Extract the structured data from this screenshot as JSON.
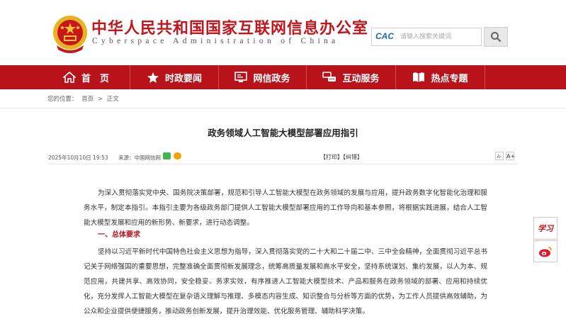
{
  "header": {
    "title": "中华人民共和国国家互联网信息办公室",
    "subtitle": "Cyberspace Administration of China",
    "search_logo": "CAC",
    "search_placeholder": "请输入搜索关键词"
  },
  "nav": {
    "items": [
      {
        "label": "首　页",
        "icon": "home-icon"
      },
      {
        "label": "时政要闻",
        "icon": "star-icon"
      },
      {
        "label": "网信政务",
        "icon": "monitor-icon"
      },
      {
        "label": "互动服务",
        "icon": "handshake-icon"
      },
      {
        "label": "热点专题",
        "icon": "book-icon"
      }
    ]
  },
  "breadcrumb": {
    "prefix": "您的位置：",
    "home": "首页",
    "sep": ">",
    "current": "正文"
  },
  "article": {
    "title": "政务领域人工智能大模型部署应用指引",
    "date": "2025年10月10日 19:53",
    "source": "来源：中国网信网",
    "print": "【打印】",
    "error": "【纠错】",
    "font_small": "A-",
    "font_large": "A+",
    "para1": "为深入贯彻落实党中央、国务院决策部署，规范和引导人工智能大模型在政务领域的发展与应用，提升政务数字化智能化治理和服务水平，制定本指引。本指引主要为各级政务部门提供人工智能大模型部署应用的工作导向和基本参照，将根据实践进展，结合人工智能大模型发展和应用的新形势、新要求，进行动态调整。",
    "section1": "一、总体要求",
    "para2": "坚持以习近平新时代中国特色社会主义思想为指导，深入贯彻落实党的二十大和二十届二中、三中全会精神，全面贯彻习近平总书记关于网络强国的重要思想，完整准确全面贯彻新发展理念，统筹高质量发展和高水平安全，坚持系统谋划、集约发展，以人为本、规范应用，共建共享、高效协同，安全稳妥、务求实效，有序推进人工智能大模型技术、产品和服务在政务领域的部署、应用和持续优化，充分发挥人工智能大模型在复杂语义理解与推理、多模态内容生成、知识整合与分析等方面的优势，为工作人员提供高效辅助，为公众和企业提供便捷服务，推动政务创新发展，提升治理效能、优化服务管理、辅助科学决策。"
  },
  "side": {
    "xuexi": "学习"
  },
  "colors": {
    "brand_red": "#b8121b",
    "title_red": "#c1161c"
  }
}
